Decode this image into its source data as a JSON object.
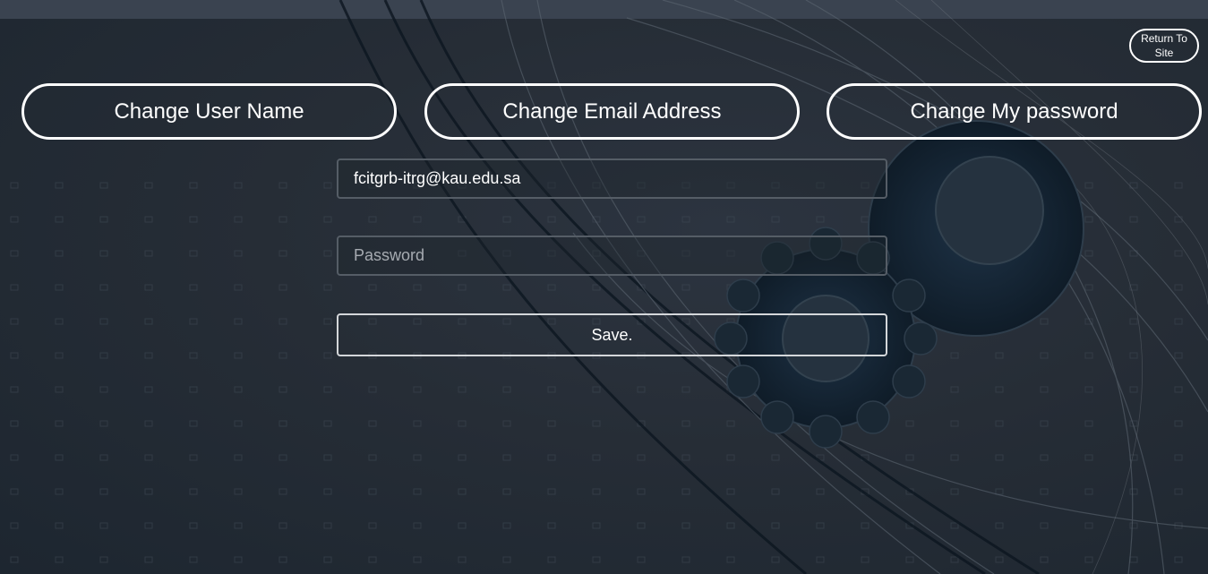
{
  "header": {
    "return_label": "Return To Site"
  },
  "tabs": [
    {
      "label": "Change User Name"
    },
    {
      "label": "Change Email Address"
    },
    {
      "label": "Change My password"
    }
  ],
  "form": {
    "email_value": "fcitgrb-itrg@kau.edu.sa",
    "password_placeholder": "Password",
    "save_label": "Save."
  },
  "colors": {
    "background": "#262d36",
    "button_border": "#ffffff",
    "field_border": "#555d66"
  }
}
